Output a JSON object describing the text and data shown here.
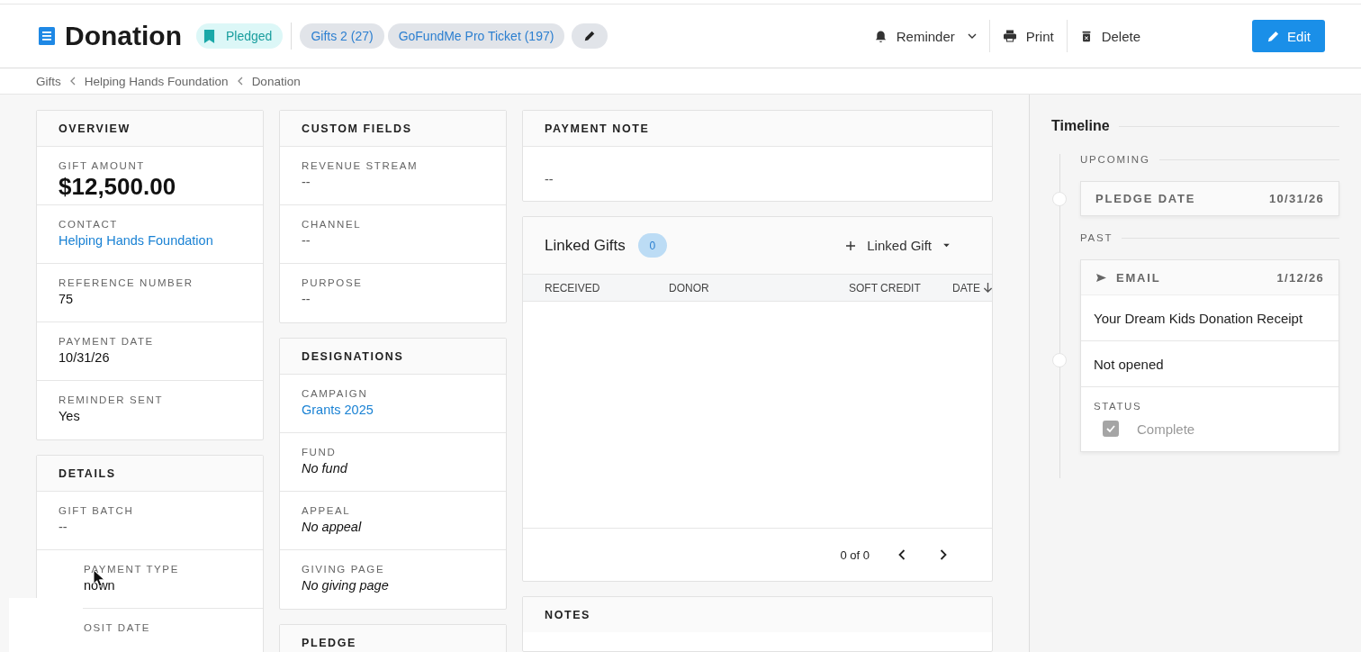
{
  "header": {
    "title": "Donation",
    "status": "Pledged",
    "chips": [
      "Gifts 2 (27)",
      "GoFundMe Pro Ticket (197)"
    ],
    "actions": [
      {
        "label": "Reminder",
        "kind": "reminder"
      },
      {
        "label": "Print",
        "kind": "print"
      },
      {
        "label": "Delete",
        "kind": "delete"
      }
    ],
    "primary": "Edit"
  },
  "breadcrumbs": [
    "Gifts",
    "Helping Hands Foundation",
    "Donation"
  ],
  "columns": [
    [
      {
        "title": "OVERVIEW",
        "fields": [
          {
            "label": "GIFT AMOUNT",
            "value": "$12,500.00",
            "kind": "amount"
          },
          {
            "label": "CONTACT",
            "value": "Helping Hands Foundation",
            "kind": "link"
          },
          {
            "label": "REFERENCE NUMBER",
            "value": "75",
            "kind": "text"
          },
          {
            "label": "PAYMENT DATE",
            "value": "10/31/26",
            "kind": "text"
          },
          {
            "label": "REMINDER SENT",
            "value": "Yes",
            "kind": "text"
          }
        ]
      },
      {
        "title": "DETAILS",
        "fields": [
          {
            "label": "GIFT BATCH",
            "value": "--",
            "kind": "empty"
          },
          {
            "label": "PAYMENT TYPE",
            "value": "nown",
            "kind": "covered"
          },
          {
            "label": "OSIT DATE",
            "kind": "covered"
          }
        ]
      }
    ],
    [
      {
        "title": "CUSTOM FIELDS",
        "fields": [
          {
            "label": "REVENUE STREAM",
            "value": "--",
            "kind": "empty"
          },
          {
            "label": "CHANNEL",
            "value": "--",
            "kind": "empty"
          },
          {
            "label": "PURPOSE",
            "value": "--",
            "kind": "empty"
          }
        ]
      },
      {
        "title": "DESIGNATIONS",
        "fields": [
          {
            "label": "CAMPAIGN",
            "value": "Grants 2025",
            "kind": "link"
          },
          {
            "label": "FUND",
            "value": "No fund",
            "kind": "italic"
          },
          {
            "label": "APPEAL",
            "value": "No appeal",
            "kind": "italic"
          },
          {
            "label": "GIVING PAGE",
            "value": "No giving page",
            "kind": "italic"
          }
        ]
      },
      {
        "title": "PLEDGE"
      }
    ]
  ],
  "payment_note": {
    "title": "PAYMENT NOTE",
    "value": "--"
  },
  "linked_gifts": {
    "title": "Linked Gifts",
    "count": "0",
    "add": "Linked Gift",
    "columns": [
      "RECEIVED",
      "DONOR",
      "SOFT CREDIT",
      "DATE"
    ],
    "pager": "0 of 0"
  },
  "notes": {
    "title": "NOTES"
  },
  "timeline": {
    "title": "Timeline",
    "groups": [
      {
        "label": "UPCOMING",
        "events": [
          {
            "kind": "simple",
            "title": "PLEDGE DATE",
            "date": "10/31/26"
          }
        ]
      },
      {
        "label": "PAST",
        "events": [
          {
            "kind": "email",
            "title": "EMAIL",
            "date": "1/12/26",
            "subject": "Your Dream Kids Donation Receipt",
            "opened": "Not opened",
            "status_label": "STATUS",
            "status": "Complete",
            "checked": true
          }
        ]
      }
    ]
  }
}
